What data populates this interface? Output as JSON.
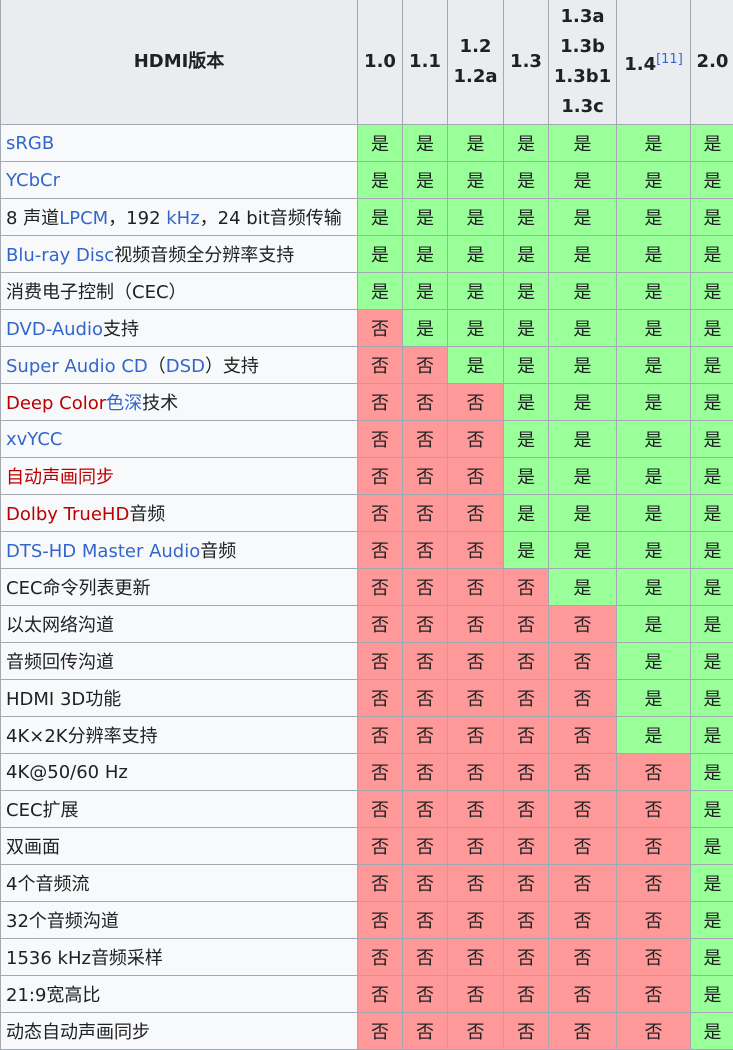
{
  "header": {
    "title": "HDMI版本",
    "versions": [
      {
        "lines": [
          "1.0"
        ]
      },
      {
        "lines": [
          "1.1"
        ]
      },
      {
        "lines": [
          "1.2",
          "1.2a"
        ]
      },
      {
        "lines": [
          "1.3"
        ]
      },
      {
        "lines": [
          "1.3a",
          "1.3b",
          "1.3b1",
          "1.3c"
        ]
      },
      {
        "lines": [
          "1.4"
        ],
        "sup": "[11]"
      },
      {
        "lines": [
          "2.0"
        ]
      }
    ]
  },
  "labels": {
    "yes": "是",
    "no": "否"
  },
  "colors": {
    "yes_bg": "#99ff99",
    "no_bg": "#ff9999",
    "link": "#3366cc",
    "redlink": "#ba0000"
  },
  "rows": [
    {
      "parts": [
        {
          "t": "sRGB",
          "c": "link"
        }
      ],
      "since": 0
    },
    {
      "parts": [
        {
          "t": "YCbCr",
          "c": "link"
        }
      ],
      "since": 0
    },
    {
      "parts": [
        {
          "t": "8 声道"
        },
        {
          "t": "LPCM",
          "c": "link"
        },
        {
          "t": "，192 "
        },
        {
          "t": "kHz",
          "c": "link"
        },
        {
          "t": "，24 bit音频传输"
        }
      ],
      "since": 0
    },
    {
      "parts": [
        {
          "t": "Blu-ray Disc",
          "c": "link"
        },
        {
          "t": "视频音频全分辨率支持"
        }
      ],
      "since": 0
    },
    {
      "parts": [
        {
          "t": "消费电子控制（CEC）"
        }
      ],
      "since": 0
    },
    {
      "parts": [
        {
          "t": "DVD-Audio",
          "c": "link"
        },
        {
          "t": "支持"
        }
      ],
      "since": 1
    },
    {
      "parts": [
        {
          "t": "Super Audio CD",
          "c": "link"
        },
        {
          "t": "（"
        },
        {
          "t": "DSD",
          "c": "link"
        },
        {
          "t": "）支持"
        }
      ],
      "since": 2
    },
    {
      "parts": [
        {
          "t": "Deep Color",
          "c": "red"
        },
        {
          "t": "色深",
          "c": "link"
        },
        {
          "t": "技术"
        }
      ],
      "since": 3
    },
    {
      "parts": [
        {
          "t": "xvYCC",
          "c": "link"
        }
      ],
      "since": 3
    },
    {
      "parts": [
        {
          "t": "自动声画同步",
          "c": "red"
        }
      ],
      "since": 3
    },
    {
      "parts": [
        {
          "t": "Dolby TrueHD",
          "c": "red"
        },
        {
          "t": "音频"
        }
      ],
      "since": 3
    },
    {
      "parts": [
        {
          "t": "DTS-HD Master Audio",
          "c": "link"
        },
        {
          "t": "音频"
        }
      ],
      "since": 3
    },
    {
      "parts": [
        {
          "t": "CEC命令列表更新"
        }
      ],
      "since": 4
    },
    {
      "parts": [
        {
          "t": "以太网络沟道"
        }
      ],
      "since": 5
    },
    {
      "parts": [
        {
          "t": "音频回传沟道"
        }
      ],
      "since": 5
    },
    {
      "parts": [
        {
          "t": "HDMI 3D功能"
        }
      ],
      "since": 5
    },
    {
      "parts": [
        {
          "t": "4K×2K分辨率支持"
        }
      ],
      "since": 5
    },
    {
      "parts": [
        {
          "t": "4K@50/60 Hz"
        }
      ],
      "since": 6
    },
    {
      "parts": [
        {
          "t": "CEC扩展"
        }
      ],
      "since": 6
    },
    {
      "parts": [
        {
          "t": "双画面"
        }
      ],
      "since": 6
    },
    {
      "parts": [
        {
          "t": "4个音频流"
        }
      ],
      "since": 6
    },
    {
      "parts": [
        {
          "t": "32个音频沟道"
        }
      ],
      "since": 6
    },
    {
      "parts": [
        {
          "t": "1536 kHz音频采样"
        }
      ],
      "since": 6
    },
    {
      "parts": [
        {
          "t": "21:9宽高比"
        }
      ],
      "since": 6
    },
    {
      "parts": [
        {
          "t": "动态自动声画同步"
        }
      ],
      "since": 6
    }
  ]
}
